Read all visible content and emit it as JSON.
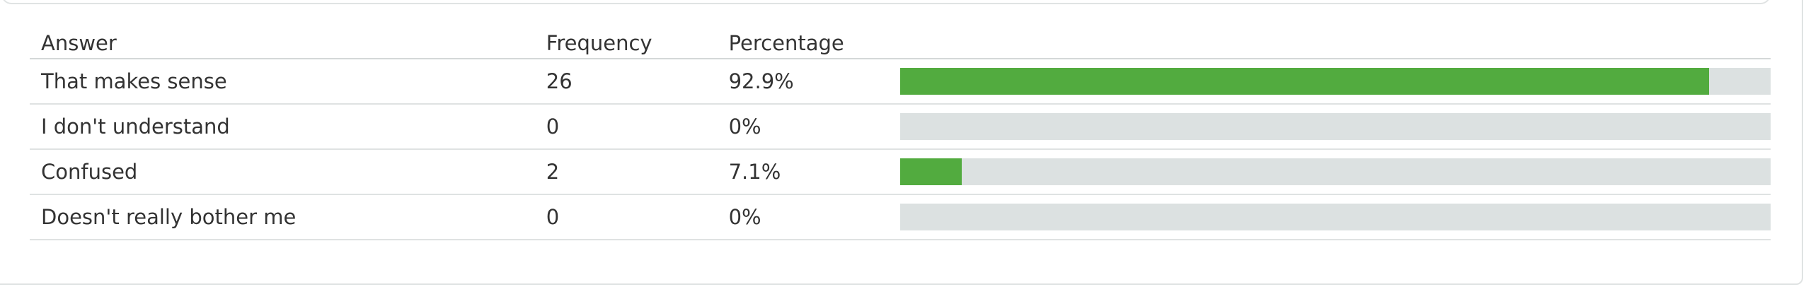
{
  "colors": {
    "bar_fill": "#52ab3f",
    "bar_track": "#dce1e1"
  },
  "table": {
    "headers": {
      "answer": "Answer",
      "frequency": "Frequency",
      "percentage": "Percentage"
    },
    "rows": [
      {
        "answer": "That makes sense",
        "frequency": "26",
        "percentage": "92.9%",
        "fraction": 0.929
      },
      {
        "answer": "I don't understand",
        "frequency": "0",
        "percentage": "0%",
        "fraction": 0.0
      },
      {
        "answer": "Confused",
        "frequency": "2",
        "percentage": "7.1%",
        "fraction": 0.071
      },
      {
        "answer": "Doesn't really bother me",
        "frequency": "0",
        "percentage": "0%",
        "fraction": 0.0
      }
    ]
  }
}
